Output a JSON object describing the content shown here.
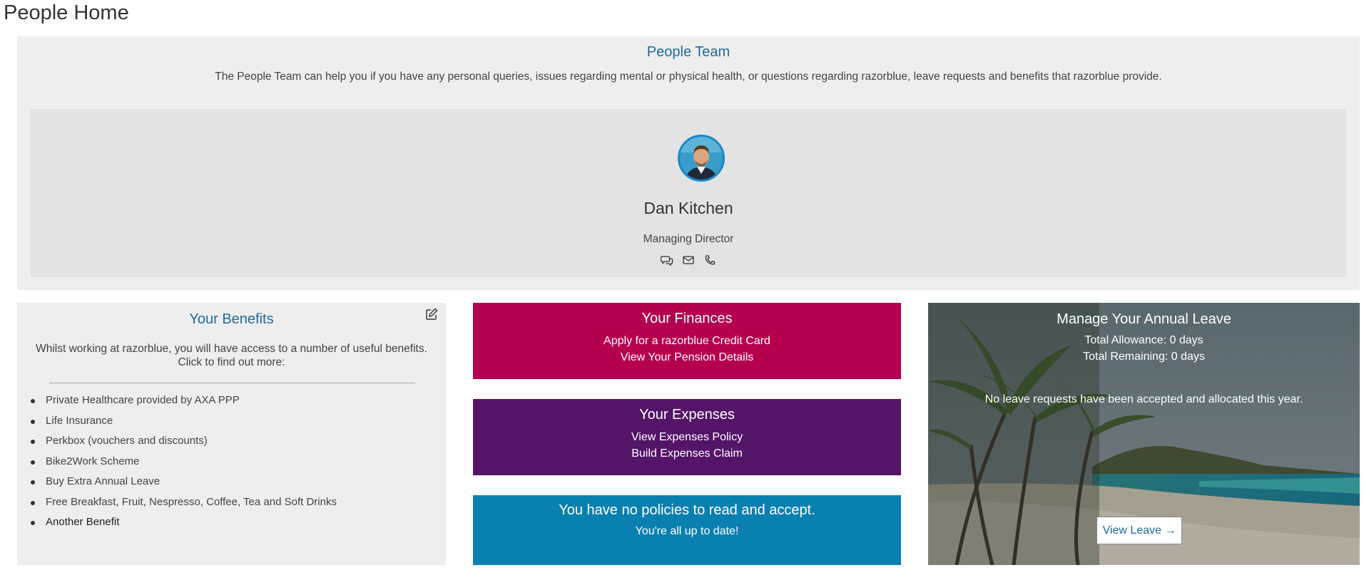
{
  "page": {
    "title": "People Home"
  },
  "people_team": {
    "title": "People Team",
    "description": "The People Team can help you if you have any personal queries, issues regarding mental or physical health, or questions regarding razorblue, leave requests and benefits that razorblue provide.",
    "contact": {
      "name": "Dan Kitchen",
      "role": "Managing Director",
      "icons": [
        "chat-icon",
        "envelope-icon",
        "phone-icon"
      ]
    }
  },
  "benefits": {
    "title": "Your Benefits",
    "description": "Whilst working at razorblue, you will have access to a number of useful benefits. Click to find out more:",
    "items": [
      "Private Healthcare provided by AXA PPP",
      "Life Insurance",
      "Perkbox (vouchers and discounts)",
      "Bike2Work Scheme",
      "Buy Extra Annual Leave",
      "Free Breakfast, Fruit, Nespresso, Coffee, Tea and Soft Drinks",
      "Another Benefit"
    ]
  },
  "finances": {
    "title": "Your Finances",
    "links": [
      "Apply for a razorblue Credit Card",
      "View Your Pension Details"
    ],
    "color": "#b5004f"
  },
  "expenses": {
    "title": "Your Expenses",
    "links": [
      "View Expenses Policy",
      "Build Expenses Claim"
    ],
    "color": "#541468"
  },
  "policies": {
    "title": "You have no policies to read and accept.",
    "subtitle": "You're all up to date!",
    "color": "#0a80b0"
  },
  "annual_leave": {
    "title": "Manage Your Annual Leave",
    "total_allowance": "Total Allowance: 0 days",
    "total_remaining": "Total Remaining: 0 days",
    "message": "No leave requests have been accepted and allocated this year.",
    "button_label": "View Leave →"
  },
  "colors": {
    "accent": "#1f6a9a",
    "panel_bg": "#eeeeee",
    "card_bg": "#e3e3e3"
  }
}
